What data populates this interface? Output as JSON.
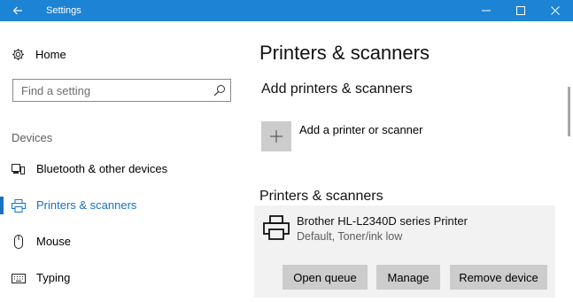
{
  "window": {
    "title": "Settings",
    "accent": "#1d83d4",
    "icons": {
      "back": "back-arrow-icon",
      "minimize": "minimize-icon",
      "maximize": "maximize-icon",
      "close": "close-icon"
    }
  },
  "sidebar": {
    "home_label": "Home",
    "search_placeholder": "Find a setting",
    "section_label": "Devices",
    "items": [
      {
        "label": "Bluetooth & other devices",
        "icon": "bluetooth-devices-icon",
        "active": false
      },
      {
        "label": "Printers & scanners",
        "icon": "printer-icon",
        "active": true
      },
      {
        "label": "Mouse",
        "icon": "mouse-icon",
        "active": false
      },
      {
        "label": "Typing",
        "icon": "keyboard-icon",
        "active": false
      }
    ],
    "active_color": "#1670c4"
  },
  "main": {
    "page_title": "Printers & scanners",
    "add_heading": "Add printers & scanners",
    "add_label": "Add a printer or scanner",
    "list_heading": "Printers & scanners",
    "printer": {
      "name": "Brother HL-L2340D series Printer",
      "status": "Default, Toner/ink low",
      "buttons": {
        "open_queue": "Open queue",
        "manage": "Manage",
        "remove": "Remove device"
      }
    }
  }
}
